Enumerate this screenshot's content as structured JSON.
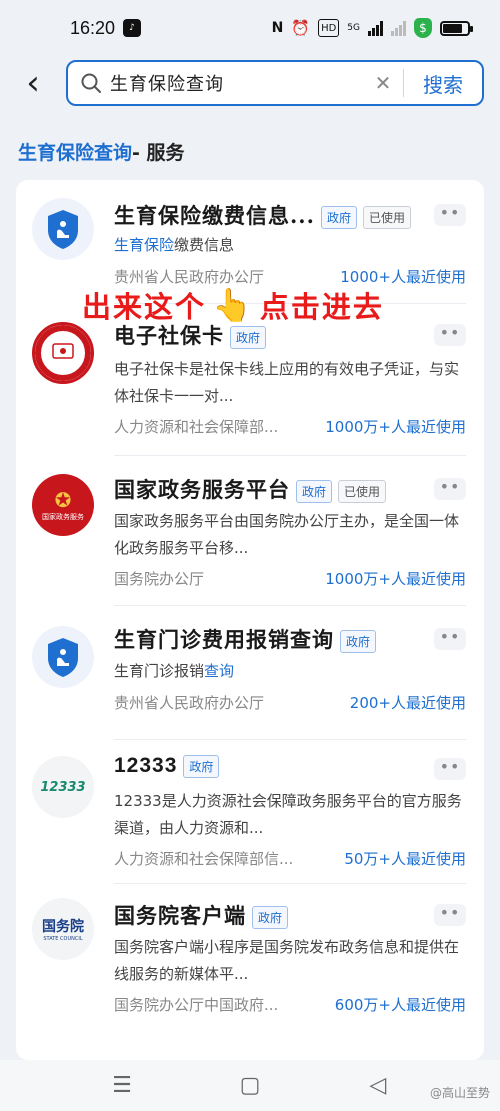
{
  "status": {
    "time": "16:20",
    "battery_level": 0.8,
    "network": "5G"
  },
  "search": {
    "query": "生育保险查询",
    "button_label": "搜索"
  },
  "section": {
    "keyword": "生育保险查询",
    "suffix": "- 服务"
  },
  "annotation": {
    "left_text": "出来这个",
    "right_text": "点击进去"
  },
  "items": [
    {
      "name": "生育保险缴费信息...",
      "tags": [
        "政府",
        "已使用"
      ],
      "desc_highlight": "生育保险",
      "desc_rest": "缴费信息",
      "org": "贵州省人民政府办公厅",
      "usage": "1000+人最近使用"
    },
    {
      "name": "电子社保卡",
      "tags": [
        "政府"
      ],
      "desc": "电子社保卡是社保卡线上应用的有效电子凭证，与实体社保卡一一对...",
      "org": "人力资源和社会保障部...",
      "usage": "1000万+人最近使用",
      "logo_text": "社会保障卡"
    },
    {
      "name": "国家政务服务平台",
      "tags": [
        "政府",
        "已使用"
      ],
      "desc": "国家政务服务平台由国务院办公厅主办，是全国一体化政务服务平台移...",
      "org": "国务院办公厅",
      "usage": "1000万+人最近使用",
      "logo_text": "国家政务服务"
    },
    {
      "name": "生育门诊费用报销查询",
      "tags": [
        "政府"
      ],
      "desc_a": "生育门诊报销",
      "desc_highlight": "查询",
      "org": "贵州省人民政府办公厅",
      "usage": "200+人最近使用"
    },
    {
      "name": "12333",
      "tags": [
        "政府"
      ],
      "desc": "12333是人力资源社会保障政务服务平台的官方服务渠道，由人力资源和...",
      "org": "人力资源和社会保障部信...",
      "usage": "50万+人最近使用",
      "logo_text": "12333"
    },
    {
      "name": "国务院客户端",
      "tags": [
        "政府"
      ],
      "desc": "国务院客户端小程序是国务院发布政务信息和提供在线服务的新媒体平...",
      "org": "国务院办公厅中国政府...",
      "usage": "600万+人最近使用",
      "logo_text": "国务院",
      "logo_sub": "STATE COUNCIL"
    }
  ],
  "watermark": "@高山至势"
}
